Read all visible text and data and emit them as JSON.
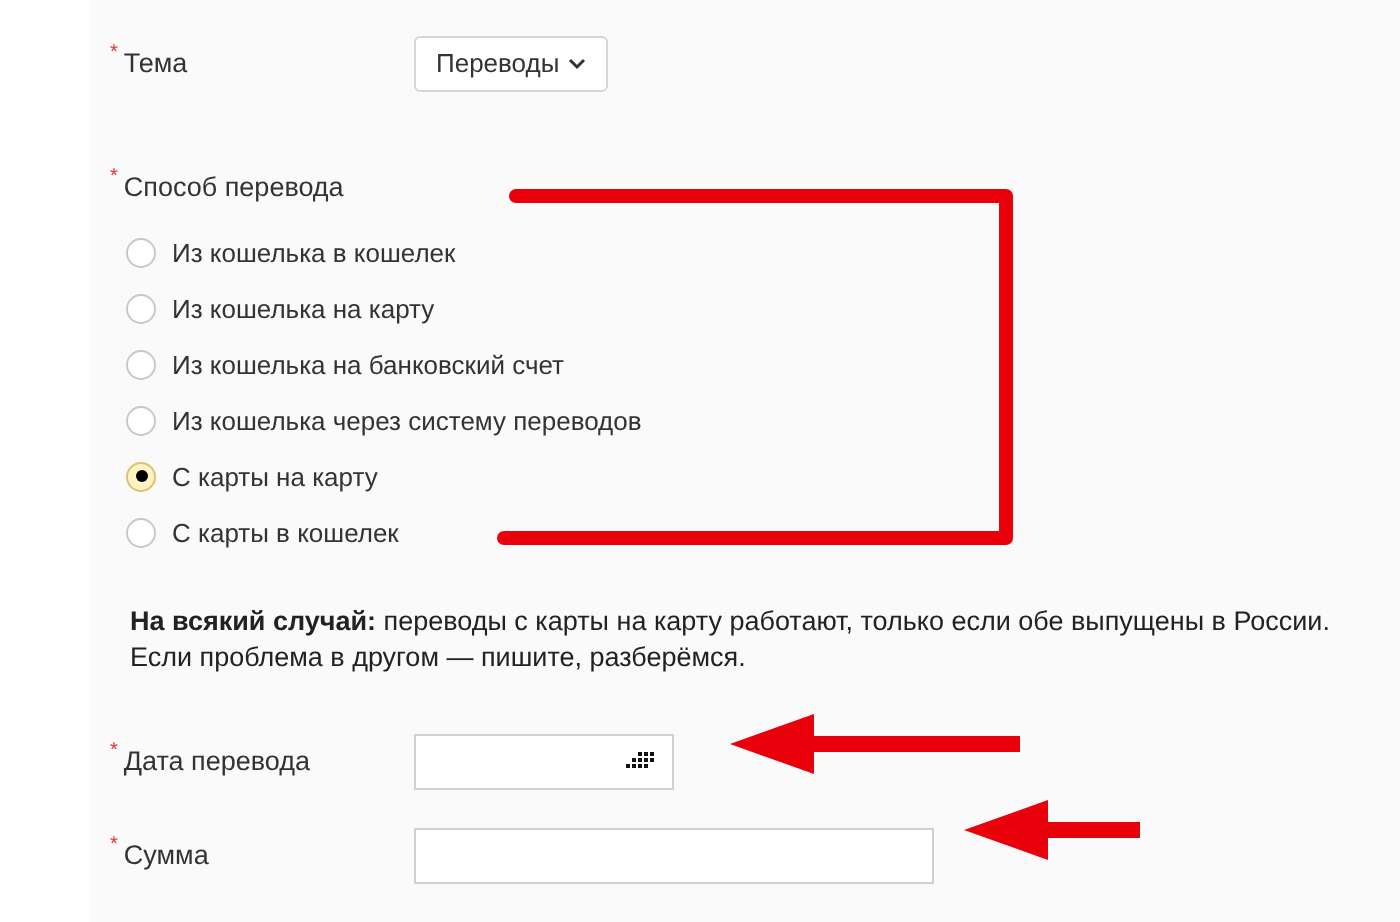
{
  "topic": {
    "required_mark": "*",
    "label": "Тема",
    "value": "Переводы"
  },
  "method": {
    "required_mark": "*",
    "label": "Способ перевода",
    "options": [
      {
        "label": "Из кошелька в кошелек",
        "selected": false
      },
      {
        "label": "Из кошелька на карту",
        "selected": false
      },
      {
        "label": "Из кошелька на банковский счет",
        "selected": false
      },
      {
        "label": "Из кошелька через систему переводов",
        "selected": false
      },
      {
        "label": "С карты на карту",
        "selected": true
      },
      {
        "label": "С карты в кошелек",
        "selected": false
      }
    ]
  },
  "note": "**На всякий случай:** переводы с карты на карту работают, только если обе выпущены в России. Если проблема в другом — пишите, разберёмся.",
  "fields": [
    {
      "kind": "date",
      "required_mark": "*",
      "label": "Дата перевода"
    },
    {
      "kind": "text",
      "required_mark": "*",
      "label": "Сумма"
    }
  ],
  "annotations": [
    {
      "kind": "bracket"
    },
    {
      "kind": "arrow"
    },
    {
      "kind": "arrow"
    }
  ]
}
